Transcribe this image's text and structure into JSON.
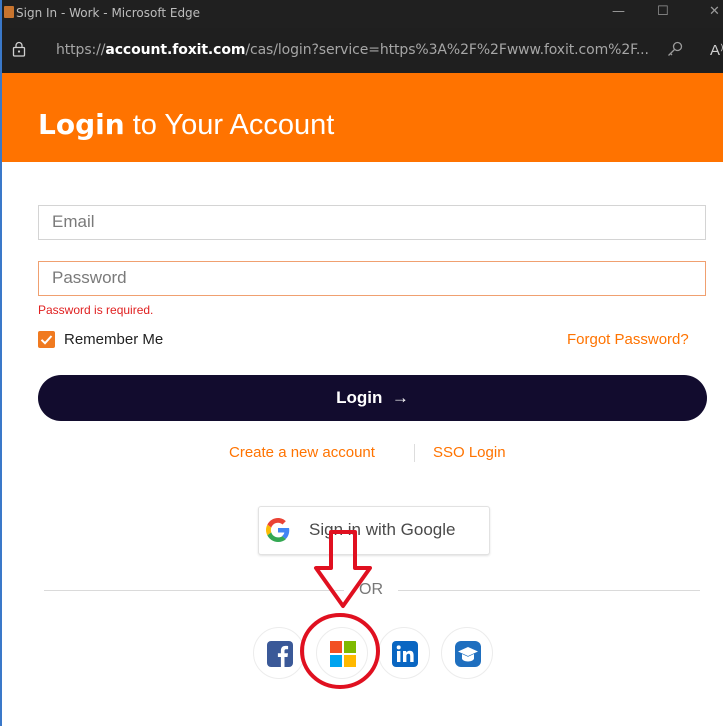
{
  "window": {
    "title": "Sign In - Work - Microsoft Edge",
    "minimize_glyph": "—",
    "maximize_glyph": "☐",
    "close_glyph": "✕"
  },
  "address_bar": {
    "url_prefix": "https://",
    "url_domain": "account.foxit.com",
    "url_rest": "/cas/login?service=https%3A%2F%2Fwww.foxit.com%2F...",
    "lock_icon": "lock-icon",
    "key_icon": "key-icon",
    "read_aloud": "A⁾"
  },
  "header": {
    "title_bold": "Login",
    "title_rest": " to Your Account",
    "color": "#ff7300"
  },
  "form": {
    "email_placeholder": "Email",
    "password_placeholder": "Password",
    "password_error": "Password is required.",
    "remember_me": "Remember Me",
    "remember_checked": true,
    "forgot_password": "Forgot Password?",
    "login_button": "Login",
    "login_arrow": "→"
  },
  "links": {
    "create_account": "Create a new account",
    "sso_login": "SSO Login"
  },
  "google": {
    "label": "Sign in with Google"
  },
  "or_label": "OR",
  "social": [
    {
      "name": "facebook-icon",
      "color": "#3b5998"
    },
    {
      "name": "microsoft-icon",
      "color": "#f25022"
    },
    {
      "name": "linkedin-icon",
      "color": "#0a66c2"
    },
    {
      "name": "education-icon",
      "color": "#1f6fbf"
    }
  ],
  "annotation": {
    "color": "#e01020"
  }
}
